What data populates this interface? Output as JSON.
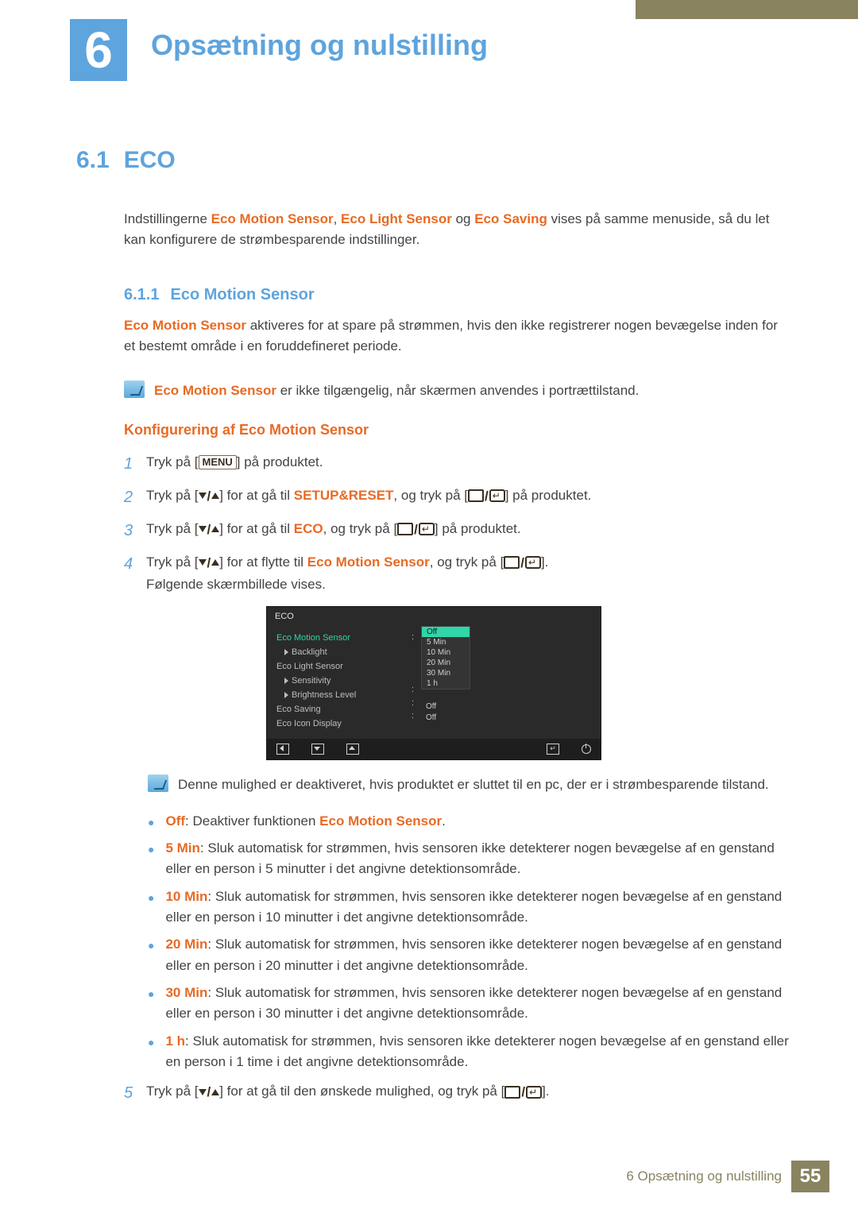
{
  "chapter": {
    "number": "6",
    "title": "Opsætning og nulstilling"
  },
  "section": {
    "number": "6.1",
    "title": "ECO"
  },
  "intro": {
    "pre": "Indstillingerne ",
    "t1": "Eco Motion Sensor",
    "sep1": ", ",
    "t2": "Eco Light Sensor",
    "sep2": " og ",
    "t3": "Eco Saving",
    "post": " vises på samme menuside, så du let kan konfigurere de strømbesparende indstillinger."
  },
  "subsection": {
    "number": "6.1.1",
    "title": "Eco Motion Sensor"
  },
  "sub_para": {
    "t": "Eco Motion Sensor",
    "rest": " aktiveres for at spare på strømmen, hvis den ikke registrerer nogen bevægelse inden for et bestemt område i en foruddefineret periode."
  },
  "note1": {
    "t": "Eco Motion Sensor",
    "rest": " er ikke tilgængelig, når skærmen anvendes i portrættilstand."
  },
  "config_heading": "Konfigurering af Eco Motion Sensor",
  "steps": {
    "s1": {
      "pre": "Tryk på [",
      "menu": "MENU",
      "post": "] på produktet."
    },
    "s2": {
      "pre": "Tryk på [",
      "mid": "] for at gå til ",
      "target": "SETUP&RESET",
      "mid2": ", og tryk på [",
      "post": "] på produktet."
    },
    "s3": {
      "pre": "Tryk på [",
      "mid": "] for at gå til ",
      "target": "ECO",
      "mid2": ", og tryk på [",
      "post": "] på produktet."
    },
    "s4": {
      "pre": "Tryk på [",
      "mid": "] for at flytte til ",
      "target": "Eco Motion Sensor",
      "mid2": ", og tryk på [",
      "post": "].",
      "line2": "Følgende skærmbillede vises."
    },
    "s5": {
      "pre": "Tryk på [",
      "mid": "] for at gå til den ønskede mulighed, og tryk på [",
      "post": "]."
    }
  },
  "osd": {
    "title": "ECO",
    "items": [
      {
        "label": "Eco Motion Sensor",
        "green": true
      },
      {
        "label": "Backlight",
        "indent": true
      },
      {
        "label": "Eco Light Sensor"
      },
      {
        "label": "Sensitivity",
        "indent": true
      },
      {
        "label": "Brightness Level",
        "indent": true
      },
      {
        "label": "Eco Saving"
      },
      {
        "label": "Eco Icon Display"
      }
    ],
    "colons": [
      ":",
      "",
      "",
      "",
      ":",
      ":",
      ":"
    ],
    "options": [
      "Off",
      "5 Min",
      "10 Min",
      "20 Min",
      "30 Min",
      "1 h"
    ],
    "right_values": {
      "row4": "",
      "row5": "Off",
      "row6": "Off"
    }
  },
  "note2": "Denne mulighed er deaktiveret, hvis produktet er sluttet til en pc, der er i strømbesparende tilstand.",
  "bullets": [
    {
      "t": "Off",
      "rest": ": Deaktiver funktionen ",
      "t2": "Eco Motion Sensor",
      "rest2": "."
    },
    {
      "t": "5 Min",
      "rest": ": Sluk automatisk for strømmen, hvis sensoren ikke detekterer nogen bevægelse af en genstand eller en person i 5 minutter i det angivne detektionsområde."
    },
    {
      "t": "10 Min",
      "rest": ": Sluk automatisk for strømmen, hvis sensoren ikke detekterer nogen bevægelse af en genstand eller en person i 10 minutter i det angivne detektionsområde."
    },
    {
      "t": "20 Min",
      "rest": ": Sluk automatisk for strømmen, hvis sensoren ikke detekterer nogen bevægelse af en genstand eller en person i 20 minutter i det angivne detektionsområde."
    },
    {
      "t": "30 Min",
      "rest": ": Sluk automatisk for strømmen, hvis sensoren ikke detekterer nogen bevægelse af en genstand eller en person i 30 minutter i det angivne detektionsområde."
    },
    {
      "t": "1 h",
      "rest": ": Sluk automatisk for strømmen, hvis sensoren ikke detekterer nogen bevægelse af en genstand eller en person i 1 time i det angivne detektionsområde."
    }
  ],
  "footer": {
    "text": "6 Opsætning og nulstilling",
    "page": "55"
  }
}
